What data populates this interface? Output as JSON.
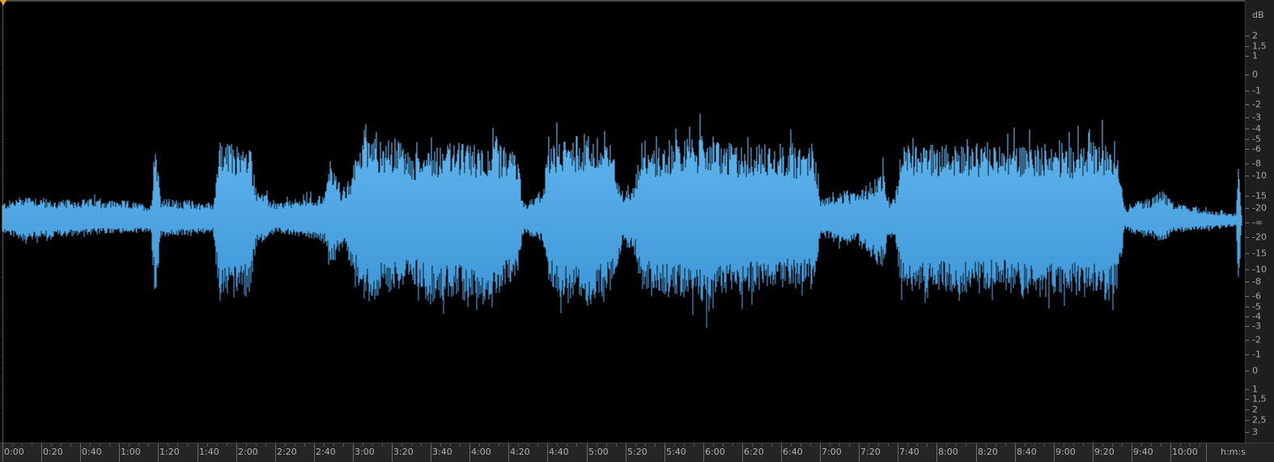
{
  "colors": {
    "background": "#000000",
    "waveform_top": "#62b8f0",
    "waveform_bottom": "#3a92d4",
    "playhead": "#f0a81c",
    "ruler_bg": "#252525",
    "ruler_text": "#b0b0b0"
  },
  "db_ruler": {
    "unit": "dB",
    "labels": [
      "2",
      "1,5",
      "1",
      "0",
      "-1",
      "-2",
      "-3",
      "-4",
      "-5",
      "-6",
      "-8",
      "-10",
      "-15",
      "-20",
      "-∞",
      "-20",
      "-15",
      "-10",
      "-8",
      "-6",
      "-5",
      "-4",
      "-3",
      "-2",
      "-1",
      "0",
      "1",
      "1,5",
      "2",
      "2,5",
      "3"
    ]
  },
  "time_ruler": {
    "unit": "h:m:s",
    "labels": [
      "0:00",
      "0:20",
      "0:40",
      "1:00",
      "1:20",
      "1:40",
      "2:00",
      "2:20",
      "2:40",
      "3:00",
      "3:20",
      "3:40",
      "4:00",
      "4:20",
      "4:40",
      "5:00",
      "5:20",
      "5:40",
      "6:00",
      "6:20",
      "6:40",
      "7:00",
      "7:20",
      "7:40",
      "8:00",
      "8:20",
      "8:40",
      "9:00",
      "9:20",
      "9:40",
      "10:00"
    ]
  },
  "waveform": {
    "name": "audio-track",
    "envelope_upper": [
      [
        0.0,
        0.08
      ],
      [
        0.02,
        0.12
      ],
      [
        0.04,
        0.09
      ],
      [
        0.07,
        0.1
      ],
      [
        0.1,
        0.09
      ],
      [
        0.12,
        0.07
      ],
      [
        0.123,
        0.42
      ],
      [
        0.128,
        0.1
      ],
      [
        0.17,
        0.08
      ],
      [
        0.175,
        0.36
      ],
      [
        0.2,
        0.34
      ],
      [
        0.205,
        0.15
      ],
      [
        0.22,
        0.08
      ],
      [
        0.26,
        0.12
      ],
      [
        0.265,
        0.3
      ],
      [
        0.275,
        0.12
      ],
      [
        0.28,
        0.18
      ],
      [
        0.29,
        0.42
      ],
      [
        0.3,
        0.45
      ],
      [
        0.305,
        0.36
      ],
      [
        0.32,
        0.38
      ],
      [
        0.33,
        0.3
      ],
      [
        0.345,
        0.35
      ],
      [
        0.36,
        0.36
      ],
      [
        0.38,
        0.35
      ],
      [
        0.4,
        0.34
      ],
      [
        0.415,
        0.32
      ],
      [
        0.42,
        0.08
      ],
      [
        0.435,
        0.12
      ],
      [
        0.44,
        0.32
      ],
      [
        0.45,
        0.38
      ],
      [
        0.47,
        0.4
      ],
      [
        0.49,
        0.36
      ],
      [
        0.5,
        0.14
      ],
      [
        0.51,
        0.16
      ],
      [
        0.515,
        0.38
      ],
      [
        0.53,
        0.34
      ],
      [
        0.54,
        0.38
      ],
      [
        0.555,
        0.38
      ],
      [
        0.57,
        0.4
      ],
      [
        0.58,
        0.36
      ],
      [
        0.6,
        0.34
      ],
      [
        0.62,
        0.36
      ],
      [
        0.64,
        0.34
      ],
      [
        0.655,
        0.34
      ],
      [
        0.66,
        0.1
      ],
      [
        0.67,
        0.12
      ],
      [
        0.68,
        0.14
      ],
      [
        0.69,
        0.12
      ],
      [
        0.7,
        0.18
      ],
      [
        0.71,
        0.24
      ],
      [
        0.715,
        0.1
      ],
      [
        0.72,
        0.12
      ],
      [
        0.725,
        0.34
      ],
      [
        0.74,
        0.36
      ],
      [
        0.76,
        0.35
      ],
      [
        0.78,
        0.36
      ],
      [
        0.8,
        0.34
      ],
      [
        0.82,
        0.35
      ],
      [
        0.84,
        0.36
      ],
      [
        0.86,
        0.34
      ],
      [
        0.88,
        0.36
      ],
      [
        0.895,
        0.38
      ],
      [
        0.9,
        0.34
      ],
      [
        0.905,
        0.05
      ],
      [
        0.91,
        0.08
      ],
      [
        0.925,
        0.1
      ],
      [
        0.935,
        0.14
      ],
      [
        0.945,
        0.08
      ],
      [
        0.96,
        0.06
      ],
      [
        0.98,
        0.04
      ],
      [
        0.995,
        0.03
      ],
      [
        0.997,
        0.38
      ],
      [
        0.999,
        0.04
      ],
      [
        1.0,
        0.02
      ]
    ],
    "envelope_lower": [
      [
        0.0,
        0.06
      ],
      [
        0.02,
        0.1
      ],
      [
        0.04,
        0.08
      ],
      [
        0.07,
        0.07
      ],
      [
        0.1,
        0.06
      ],
      [
        0.12,
        0.06
      ],
      [
        0.123,
        0.4
      ],
      [
        0.128,
        0.08
      ],
      [
        0.17,
        0.06
      ],
      [
        0.175,
        0.38
      ],
      [
        0.2,
        0.34
      ],
      [
        0.205,
        0.12
      ],
      [
        0.22,
        0.06
      ],
      [
        0.26,
        0.1
      ],
      [
        0.265,
        0.22
      ],
      [
        0.275,
        0.12
      ],
      [
        0.28,
        0.2
      ],
      [
        0.29,
        0.36
      ],
      [
        0.3,
        0.4
      ],
      [
        0.305,
        0.34
      ],
      [
        0.32,
        0.32
      ],
      [
        0.33,
        0.3
      ],
      [
        0.345,
        0.38
      ],
      [
        0.36,
        0.36
      ],
      [
        0.38,
        0.38
      ],
      [
        0.4,
        0.36
      ],
      [
        0.415,
        0.26
      ],
      [
        0.42,
        0.06
      ],
      [
        0.435,
        0.1
      ],
      [
        0.44,
        0.28
      ],
      [
        0.45,
        0.36
      ],
      [
        0.47,
        0.4
      ],
      [
        0.49,
        0.34
      ],
      [
        0.5,
        0.12
      ],
      [
        0.51,
        0.14
      ],
      [
        0.515,
        0.32
      ],
      [
        0.53,
        0.34
      ],
      [
        0.54,
        0.36
      ],
      [
        0.555,
        0.36
      ],
      [
        0.57,
        0.42
      ],
      [
        0.58,
        0.36
      ],
      [
        0.6,
        0.34
      ],
      [
        0.62,
        0.32
      ],
      [
        0.64,
        0.32
      ],
      [
        0.655,
        0.3
      ],
      [
        0.66,
        0.06
      ],
      [
        0.67,
        0.1
      ],
      [
        0.68,
        0.12
      ],
      [
        0.69,
        0.1
      ],
      [
        0.7,
        0.2
      ],
      [
        0.71,
        0.22
      ],
      [
        0.715,
        0.08
      ],
      [
        0.72,
        0.1
      ],
      [
        0.725,
        0.32
      ],
      [
        0.74,
        0.34
      ],
      [
        0.76,
        0.34
      ],
      [
        0.78,
        0.34
      ],
      [
        0.8,
        0.32
      ],
      [
        0.82,
        0.34
      ],
      [
        0.84,
        0.36
      ],
      [
        0.86,
        0.34
      ],
      [
        0.88,
        0.36
      ],
      [
        0.895,
        0.38
      ],
      [
        0.9,
        0.3
      ],
      [
        0.905,
        0.04
      ],
      [
        0.91,
        0.06
      ],
      [
        0.925,
        0.08
      ],
      [
        0.935,
        0.1
      ],
      [
        0.945,
        0.06
      ],
      [
        0.96,
        0.05
      ],
      [
        0.98,
        0.04
      ],
      [
        0.995,
        0.03
      ],
      [
        0.997,
        0.36
      ],
      [
        0.999,
        0.03
      ],
      [
        1.0,
        0.02
      ]
    ]
  }
}
